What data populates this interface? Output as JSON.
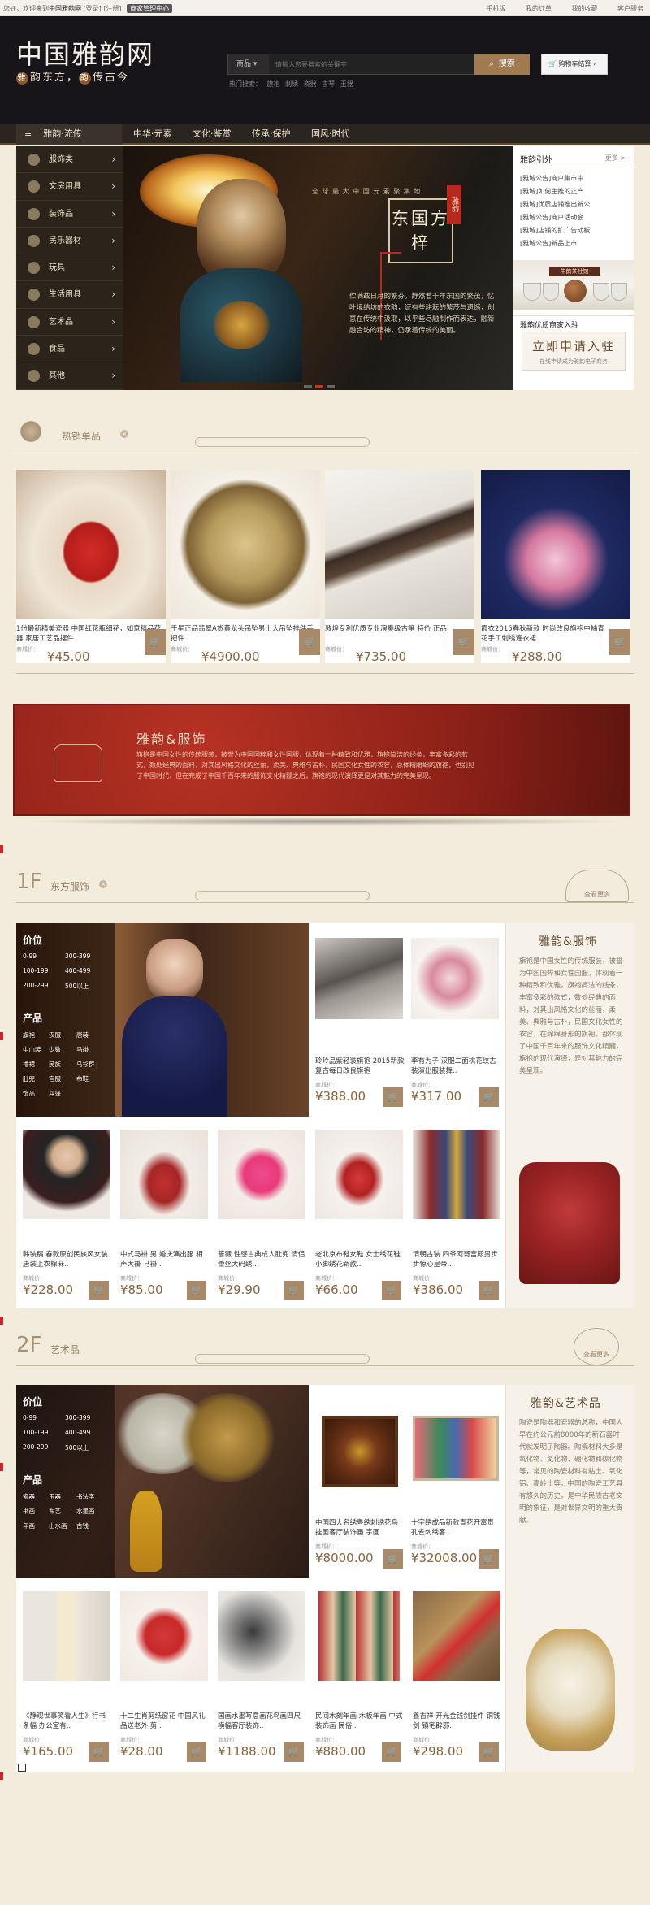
{
  "topbar": {
    "greeting": "您好，欢迎来到",
    "site_name": "中国雅韵网",
    "login": "[登录]",
    "register": "[注册]",
    "merchant_badge": "商家管理中心",
    "links": [
      "手机版",
      "我的订单",
      "我的收藏",
      "客户服务"
    ]
  },
  "header": {
    "logo": "中国雅韵网",
    "slogan_1": "雅",
    "slogan_text_1": "韵东方，",
    "slogan_2": "韵",
    "slogan_text_2": "传古今",
    "search_category": "商品",
    "search_placeholder": "请输入您要搜索的关键字",
    "search_button": "搜索",
    "hot_words": "热门搜索： 旗袍 刺绣 瓷器 古琴 玉器",
    "cart_label": "购物车结算"
  },
  "nav": {
    "category_header": "雅韵·流传",
    "items": [
      "中华·元素",
      "文化·鉴赏",
      "传承·保护",
      "国风·时代"
    ]
  },
  "sidebar": {
    "items": [
      {
        "label": "服饰类"
      },
      {
        "label": "文房用具"
      },
      {
        "label": "装饰品"
      },
      {
        "label": "民乐器材"
      },
      {
        "label": "玩具"
      },
      {
        "label": "生活用具"
      },
      {
        "label": "艺术品"
      },
      {
        "label": "食品"
      },
      {
        "label": "其他"
      }
    ]
  },
  "banner": {
    "tagline": "全 球 最 大 中 国 元 素 聚 集 地",
    "stamp": "雅韵",
    "title": "东国方梓",
    "description": "伫满载日月的繁芬，静然看千年东国的繁茂，忆叶境结坊的衣韵，证有些耕耘的繁茂与遗憾，创意在传统中汲取，以乎些尽融制作而表达，融新融合坊的精神，仍承着传统的美丽。",
    "dots": [
      false,
      true,
      false
    ]
  },
  "right_panel": {
    "title": "雅韵引外",
    "more": "更多 >",
    "news": [
      "[雅城公告]商户集市中",
      "[雅城]如何主推的正产",
      "[雅城]优质店铺推出新公",
      "[雅城公告]商户活动会",
      "[雅城]店铺的扩广告动板",
      "[雅城公告]新品上市"
    ],
    "shop_banner": "牛韵茶社馆",
    "join_title": "雅韵优质商家入驻",
    "apply": "立即申请入驻",
    "apply_sub": "在线申请成为雅韵电子商务"
  },
  "hot": {
    "title": "热销单品",
    "products": [
      {
        "name": "1份最新精美瓷器 中国红花瓶细花，如意精品花器 家居工艺品摆件",
        "price": "¥45.00",
        "mark": "商城价：",
        "cart": "🛒"
      },
      {
        "name": "千星正品翡翠A货黄龙头吊坠男士大吊坠挂件手把件",
        "price": "¥4900.00",
        "mark": "商城价：",
        "cart": "🛒"
      },
      {
        "name": "敦煌专利优质专业演奏级古筝 特价 正品",
        "price": "¥735.00",
        "mark": "商城价：",
        "cart": "🛒"
      },
      {
        "name": "霞衣2015春秋新款 时尚改良旗袍中袖青花手工刺绣连衣裙",
        "price": "¥288.00",
        "mark": "商城价：",
        "cart": "🛒"
      }
    ]
  },
  "feature": {
    "title": "雅韵&服饰",
    "text": "旗袍是中国女性的传统服装，被誉为中国国粹和女性国服，体现着一种精致和优雅，旗袍简洁的线条，丰富多彩的款式，数处经典的面料，对其出风格文化的丝丽，柔美、典雅与古朴，民国文化女性的衣容，总体精雕细的旗袍，也别见了中国时代，但在完成了中国千百年来的服饰文化精髓之后，旗袍的现代演绎更是对其魅力的完美呈现。"
  },
  "floor1": {
    "num": "1F",
    "title": "东方服饰",
    "more": "查看更多",
    "filter": {
      "price_title": "价位",
      "prices": [
        "0-99",
        "300-399",
        "100-199",
        "400-499",
        "200-299",
        "500以上"
      ],
      "product_title": "产品",
      "products": [
        "旗袍",
        "汉服",
        "唐装",
        "中山装",
        "少数",
        "马褂",
        "襦裙",
        "民族",
        "乌衫群",
        "肚兜",
        "宫服",
        "布鞋",
        "饰品",
        "斗篷"
      ]
    },
    "desc_title": "雅韵&服饰",
    "desc": "旗袍是中国女性的传统服装，被誉为中国国粹和女性国服，体现着一种精致和优雅，旗袍简洁的线条，丰富多彩的款式，数处经典的面料，对其出风格文化的丝丽，柔美、典雅与古朴，民国文化女性的衣容，在绵绵身形的旗袍，都体现了中国千百年来的服饰文化精髓，旗袍的现代演绎，是对其魅力的完美呈现。",
    "top_products": [
      {
        "name": "玲玲品紫轻装旗袍 2015新款复古每日改良旗袍",
        "price": "¥388.00",
        "mark": "商城价："
      },
      {
        "name": "李有为子 汉服二面桃花纹古装演出服装舞..",
        "price": "¥317.00",
        "mark": "商城价："
      }
    ],
    "products": [
      {
        "name": "韩装稿 春款原创民族风女装唐装上衣棉麻..",
        "price": "¥228.00",
        "mark": "商城价："
      },
      {
        "name": "中式马褂 男 婚庆演出服 相声大褂 马褂..",
        "price": "¥85.00",
        "mark": "商城价："
      },
      {
        "name": "蔷薇 性感古典成人肚兜 情侣蕾丝大码绣..",
        "price": "¥29.90",
        "mark": "商城价："
      },
      {
        "name": "老北京布鞋女鞋 女士绣花鞋小脚绣花新款..",
        "price": "¥66.00",
        "mark": "商城价："
      },
      {
        "name": "清朝古装 四爷阿哥宫殿男步步惊心皇帝..",
        "price": "¥386.00",
        "mark": "商城价："
      }
    ]
  },
  "floor2": {
    "num": "2F",
    "title": "艺术品",
    "more": "查看更多",
    "filter": {
      "price_title": "价位",
      "prices": [
        "0-99",
        "300-399",
        "100-199",
        "400-499",
        "200-299",
        "500以上"
      ],
      "product_title": "产品",
      "products": [
        "瓷器",
        "玉器",
        "书法字",
        "书画",
        "布艺",
        "水墨画",
        "年画",
        "山水画",
        "古钱"
      ]
    },
    "desc_title": "雅韵&艺术品",
    "desc": "陶瓷是陶器和瓷器的总称，中国人早在约公元前8000年的新石器时代就发明了陶器。陶瓷材料大多是氧化物、氮化物、硼化物和碳化物等，常见的陶瓷材料有粘土、氧化铝、高岭土等，中国的陶瓷工艺具有悠久的历史，是中华民族古老文明的象征，是对世界文明的重大贡献。",
    "top_products": [
      {
        "name": "中国四大名绣粤绣刺绣花鸟挂画客厅装饰画 字画",
        "price": "¥8000.00",
        "mark": "商城价："
      },
      {
        "name": "十字绣成品新款青花开富贵孔雀刺绣客..",
        "price": "¥32008.00",
        "mark": "商城价："
      }
    ],
    "products": [
      {
        "name": "《静观世事笑看人生》行书条幅 办公室有..",
        "price": "¥165.00",
        "mark": "商城价："
      },
      {
        "name": "十二生肖剪纸窗花 中国风礼品送老外 剪..",
        "price": "¥28.00",
        "mark": "商城价："
      },
      {
        "name": "国画水墨写意画花鸟画四尺横幅客厅装饰..",
        "price": "¥1188.00",
        "mark": "商城价："
      },
      {
        "name": "民间木刻年画 木板年画 中式装饰画 民俗..",
        "price": "¥880.00",
        "mark": "商城价："
      },
      {
        "name": "鑫吉祥 开光金钱剑挂件 铜钱剑 镇宅辟邪..",
        "price": "¥298.00",
        "mark": "商城价："
      }
    ]
  },
  "icons": [
    "search-icon",
    "cart-icon",
    "chevron-right-icon",
    "close-icon",
    "knot-icon"
  ]
}
